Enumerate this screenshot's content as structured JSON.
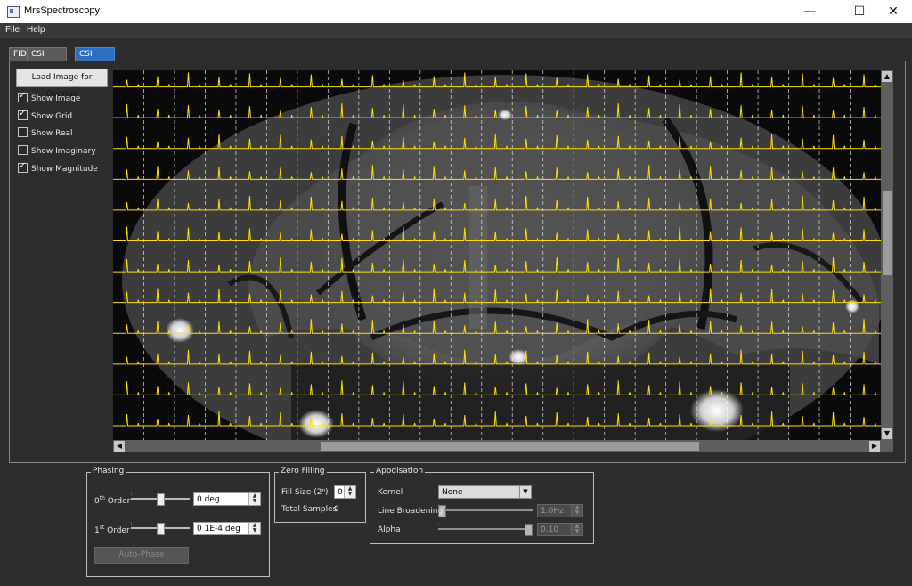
{
  "window": {
    "title": "MrsSpectroscopy",
    "minimize": "—",
    "maximize": "☐",
    "close": "✕"
  },
  "menu": [
    {
      "label": "File"
    },
    {
      "label": "Help"
    }
  ],
  "tabs": [
    {
      "label": "FID"
    },
    {
      "label": "CSI Spectra"
    },
    {
      "label": "CSI Overlay",
      "active": true
    }
  ],
  "overlay": {
    "load_button": "Load Image for Overlay",
    "checkboxes": [
      {
        "label": "Show Image",
        "checked": true
      },
      {
        "label": "Show Grid",
        "checked": true
      },
      {
        "label": "Show Real",
        "checked": false
      },
      {
        "label": "Show Imaginary",
        "checked": false
      },
      {
        "label": "Show Magnitude",
        "checked": true
      }
    ],
    "spectrum_color": "#ffe000",
    "grid_color": "#ffffff"
  },
  "phasing": {
    "title": "Phasing",
    "zero_order_label": "0",
    "zero_order_sup": "th",
    "order_word": " Order",
    "zero_order_value": "0 deg",
    "first_order_label": "1",
    "first_order_sup": "st",
    "first_order_value": "0 1E-4 deg",
    "zero_order_slider_level": 0.5,
    "first_order_slider_level": 0.5,
    "auto_phase": "Auto-Phase"
  },
  "zero_filling": {
    "title": "Zero Filling",
    "fill_size_label": "Fill Size (2ⁿ)",
    "fill_size_value": "0",
    "total_samples_label": "Total Samples",
    "total_samples_value": "0"
  },
  "apodisation": {
    "title": "Apodisation",
    "kernel_label": "Kernel",
    "kernel_value": "None",
    "line_broadening_label": "Line Broadening",
    "line_broadening_value": "1.0Hz",
    "line_broadening_level": 0.0,
    "alpha_label": "Alpha",
    "alpha_value": "0.10",
    "alpha_level": 1.0
  }
}
